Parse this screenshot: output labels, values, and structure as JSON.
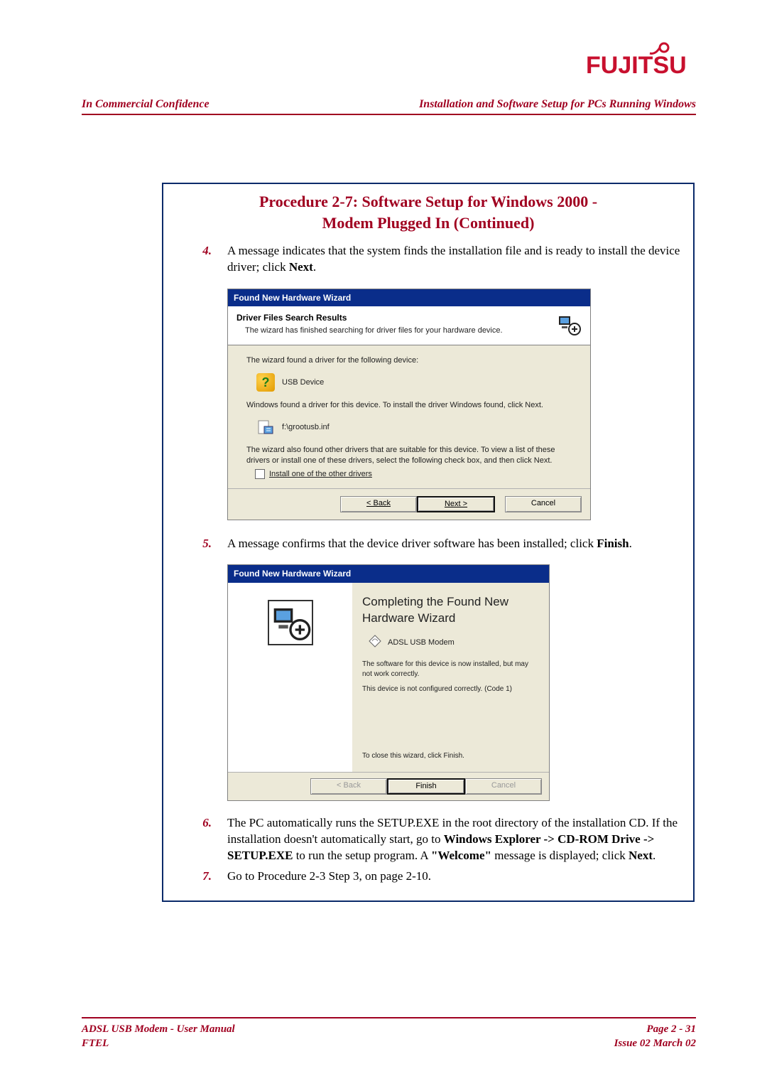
{
  "brand": {
    "name": "FUJITSU",
    "accent": "#a00020",
    "blue": "#0a2a6a"
  },
  "header": {
    "left": "In Commercial Confidence",
    "right": "Installation and Software Setup for PCs Running Windows"
  },
  "procedure": {
    "title_line1": "Procedure 2-7: Software Setup for Windows 2000 -",
    "title_line2": "Modem Plugged In (Continued)"
  },
  "steps": {
    "s4": {
      "num": "4.",
      "text_a": "A message indicates that the system finds the installation file and is ready to install the device driver; click ",
      "text_b": "Next",
      "text_c": "."
    },
    "s5": {
      "num": "5.",
      "text_a": "A message confirms that the device driver software has been installed; click ",
      "text_b": "Finish",
      "text_c": "."
    },
    "s6": {
      "num": "6.",
      "text_a": "The PC automatically runs the SETUP.EXE in the root directory of the installation CD. If the installation doesn't automatically start, go to ",
      "bold1": "Windows Explorer -> CD-ROM Drive -> SETUP.EXE",
      "text_b": " to run the setup program. A ",
      "bold2": "\"Welcome\"",
      "text_c": " message is displayed; click ",
      "bold3": "Next",
      "text_d": "."
    },
    "s7": {
      "num": "7.",
      "text": "Go to Procedure 2-3 Step 3, on page 2-10."
    }
  },
  "wizard1": {
    "title": "Found New Hardware Wizard",
    "heading": "Driver Files Search Results",
    "subheading": "The wizard has finished searching for driver files for your hardware device.",
    "line1": "The wizard found a driver for the following device:",
    "device": "USB Device",
    "line2": "Windows found a driver for this device. To install the driver Windows found, click Next.",
    "file": "f:\\grootusb.inf",
    "line3": "The wizard also found other drivers that are suitable for this device. To view a list of these drivers or install one of these drivers, select the following check box, and then click Next.",
    "checkbox": "Install one of the other drivers",
    "btn_back": "< Back",
    "btn_next": "Next >",
    "btn_cancel": "Cancel"
  },
  "wizard2": {
    "title": "Found New Hardware Wizard",
    "heading": "Completing the Found New Hardware Wizard",
    "device": "ADSL USB Modem",
    "msg1": "The software for this device is now installed, but may not work correctly.",
    "msg2": "This device is not configured correctly. (Code 1)",
    "close": "To close this wizard, click Finish.",
    "btn_back": "< Back",
    "btn_finish": "Finish",
    "btn_cancel": "Cancel"
  },
  "footer": {
    "left1": "ADSL USB Modem - User Manual",
    "left2": "FTEL",
    "right1": "Page 2 - 31",
    "right2": "Issue 02 March 02"
  }
}
